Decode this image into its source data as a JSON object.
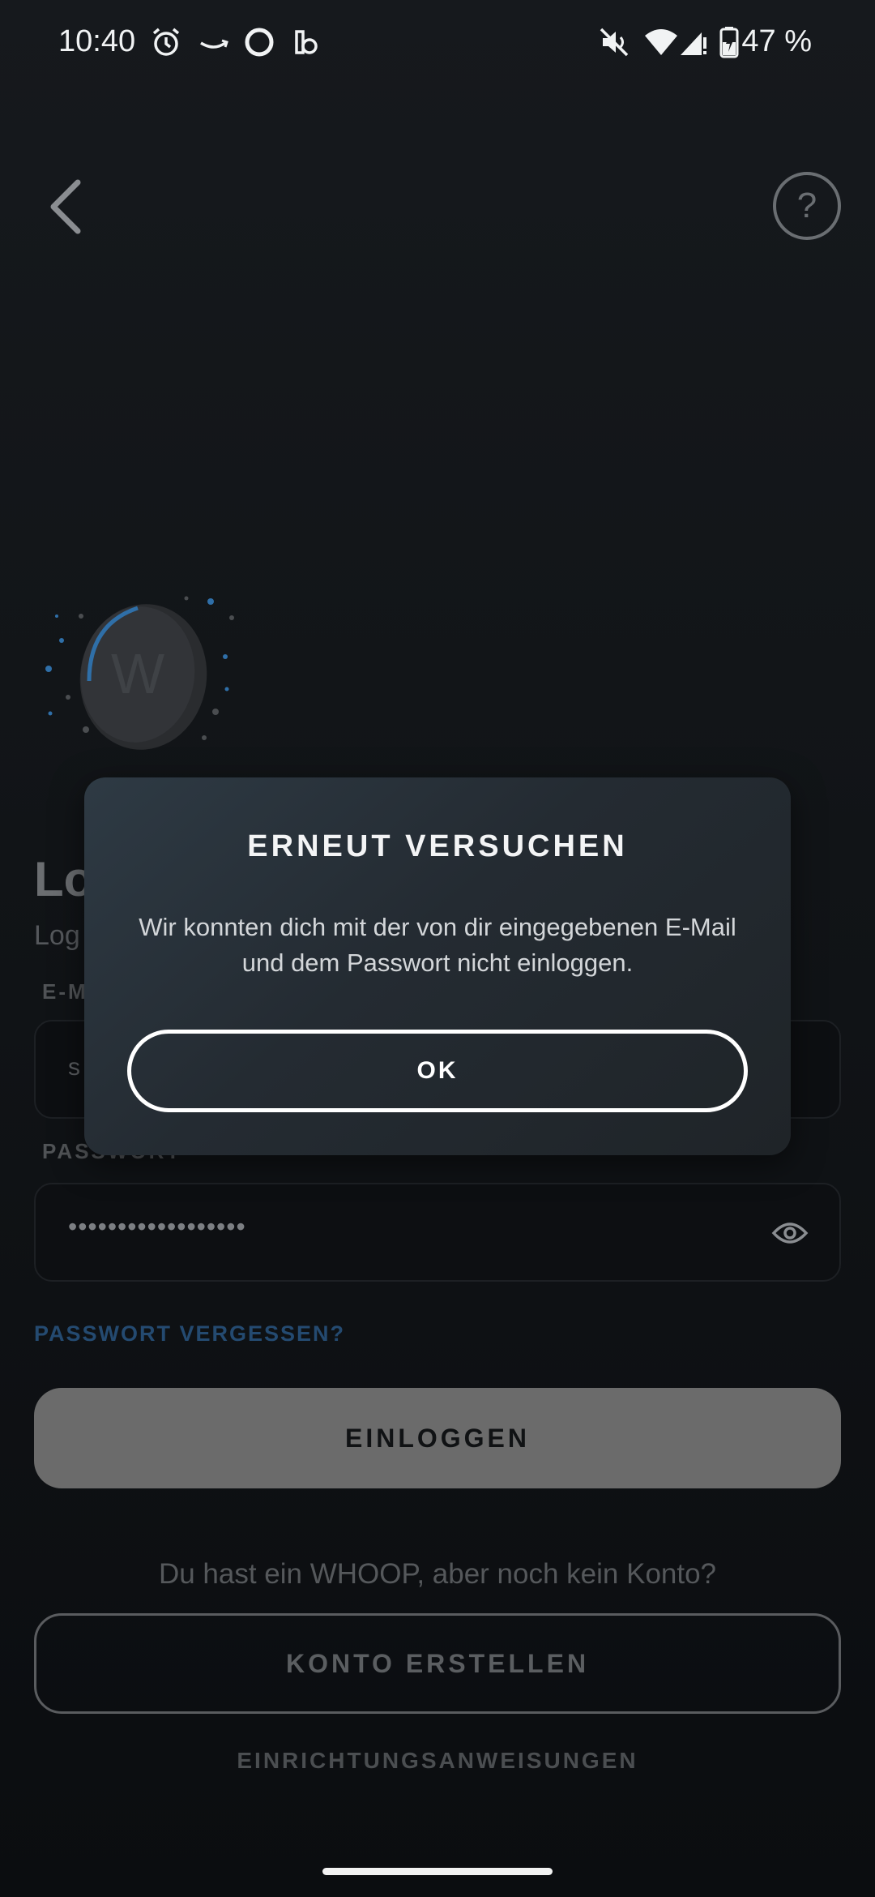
{
  "status_bar": {
    "time": "10:40",
    "battery_percent": "47 %",
    "icons": [
      "alarm-icon",
      "amazon-icon",
      "circle-app-icon",
      "app-icon",
      "mute-icon",
      "wifi-icon",
      "signal-icon",
      "battery-icon"
    ]
  },
  "nav": {
    "back_icon": "chevron-left-icon",
    "help_symbol": "?"
  },
  "brand": {
    "device_letter": "W"
  },
  "login": {
    "title_visible": "Lo",
    "subtitle_visible": "Log",
    "email_label_visible": "E-M",
    "email_value_visible": "s",
    "password_label_visible": "PASSWORT",
    "password_value": "••••••••••••••••••",
    "forgot_link": "PASSWORT VERGESSEN?",
    "login_button": "EINLOGGEN",
    "no_account_text": "Du hast ein WHOOP, aber noch kein Konto?",
    "create_account_button": "KONTO ERSTELLEN",
    "setup_link": "EINRICHTUNGSANWEISUNGEN"
  },
  "dialog": {
    "title": "ERNEUT VERSUCHEN",
    "message": "Wir konnten dich mit der von dir eingegebenen E-Mail und dem Passwort nicht einloggen.",
    "ok_button": "OK"
  },
  "colors": {
    "accent_link": "#244a70",
    "background": "#111417",
    "dialog_bg": "#2a333b",
    "login_button_bg": "#6b6b6b"
  }
}
